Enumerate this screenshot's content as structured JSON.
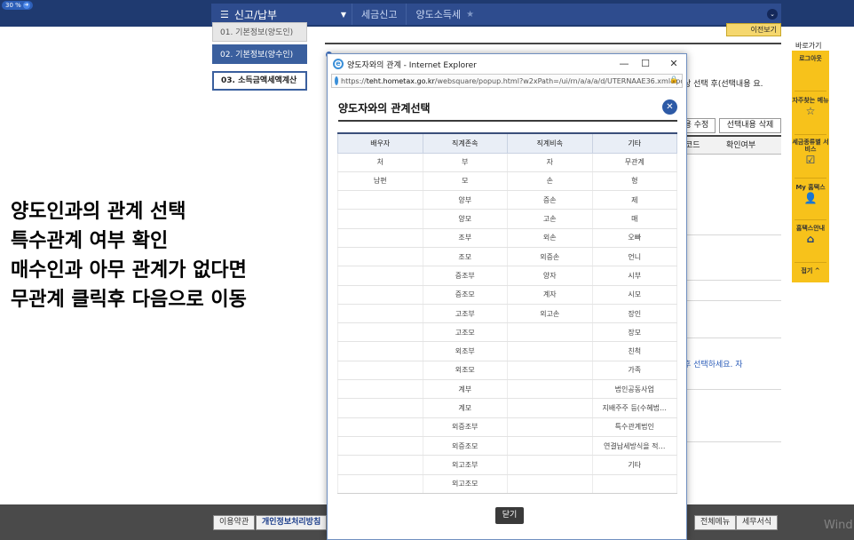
{
  "zoom": "30 %",
  "nav": {
    "menu_label": "신고/납부",
    "breadcrumbs": [
      "세금신고",
      "양도소득세"
    ]
  },
  "steps": [
    "01. 기본정보(양도인)",
    "02. 기본정보(양수인)",
    "03. 소득금액세액계산"
  ],
  "background": {
    "prev_button": "이전보기",
    "tip_text": "상 선택 후(선택내용 요.",
    "modify_button": "용 수정",
    "delete_button": "선택내용 삭제",
    "col_code": "코드",
    "col_confirm": "확인여부",
    "notice_text": "후 선택하세요. 자"
  },
  "quick_menu": {
    "title": "바로가기",
    "items": [
      "로그아웃",
      "자주찾는 메뉴",
      "세금종류별 서비스",
      "My 홈택스",
      "홈택스안내"
    ],
    "fold": "접기 ^"
  },
  "overlay_lines": [
    "양도인과의 관계 선택",
    "특수관계 여부 확인",
    "매수인과 아무 관계가 없다면",
    "무관계 클릭후 다음으로 이동"
  ],
  "footer": {
    "terms": "이용약관",
    "privacy": "개인정보처리방침",
    "all_menu": "전체메뉴",
    "sites": "세무서식",
    "watermark": "Wind"
  },
  "popup": {
    "window_title": "양도자와의 관계 - Internet Explorer",
    "url_prefix": "https://",
    "url_host": "teht.hometax.go.kr",
    "url_path": "/websquare/popup.html?w2xPath=/ui/rn/a/a/a/d/UTERNAAE36.xml&popupi",
    "heading": "양도자와의 관계선택",
    "close_button": "닫기",
    "table": {
      "headers": [
        "배우자",
        "직계존속",
        "직계비속",
        "기타"
      ],
      "rows": [
        [
          "처",
          "부",
          "자",
          "무관계"
        ],
        [
          "남편",
          "모",
          "손",
          "형"
        ],
        [
          "",
          "양부",
          "증손",
          "제"
        ],
        [
          "",
          "양모",
          "고손",
          "매"
        ],
        [
          "",
          "조부",
          "외손",
          "오빠"
        ],
        [
          "",
          "조모",
          "외증손",
          "언니"
        ],
        [
          "",
          "증조부",
          "양자",
          "시부"
        ],
        [
          "",
          "증조모",
          "계자",
          "시모"
        ],
        [
          "",
          "고조부",
          "외고손",
          "장인"
        ],
        [
          "",
          "고조모",
          "",
          "장모"
        ],
        [
          "",
          "외조부",
          "",
          "친척"
        ],
        [
          "",
          "외조모",
          "",
          "가족"
        ],
        [
          "",
          "계부",
          "",
          "법인공동사업"
        ],
        [
          "",
          "계모",
          "",
          "지배주주 등(수혜법…"
        ],
        [
          "",
          "외증조부",
          "",
          "특수관계법인"
        ],
        [
          "",
          "외증조모",
          "",
          "연결납세방식을 적…"
        ],
        [
          "",
          "외고조부",
          "",
          "기타"
        ],
        [
          "",
          "외고조모",
          "",
          ""
        ]
      ]
    }
  }
}
